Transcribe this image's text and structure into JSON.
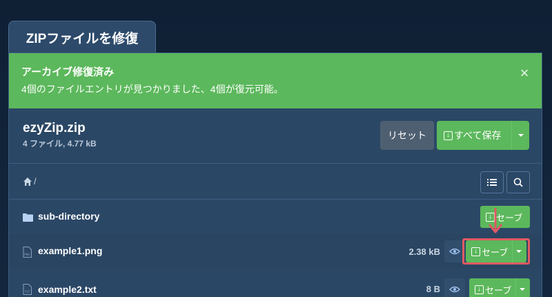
{
  "tab": {
    "title": "ZIPファイルを修復"
  },
  "alert": {
    "title": "アーカイブ修復済み",
    "message": "4個のファイルエントリが見つかりました、4個が復元可能。",
    "close_glyph": "×"
  },
  "archive": {
    "name": "ezyZip.zip",
    "meta": "4 ファイル, 4.77 kB",
    "reset_label": "リセット",
    "save_all_label": "すべて保存"
  },
  "path": {
    "text": "/"
  },
  "rows": [
    {
      "type": "folder",
      "name": "sub-directory",
      "size": "",
      "save_label": "セーブ"
    },
    {
      "type": "file",
      "ext": "PNG",
      "name": "example1.png",
      "size": "2.38 kB",
      "save_label": "セーブ"
    },
    {
      "type": "file",
      "ext": "TXT",
      "name": "example2.txt",
      "size": "8 B",
      "save_label": "セーブ"
    }
  ],
  "colors": {
    "success": "#5cb85c",
    "panel": "#2b4766",
    "highlight": "#e05a62"
  }
}
